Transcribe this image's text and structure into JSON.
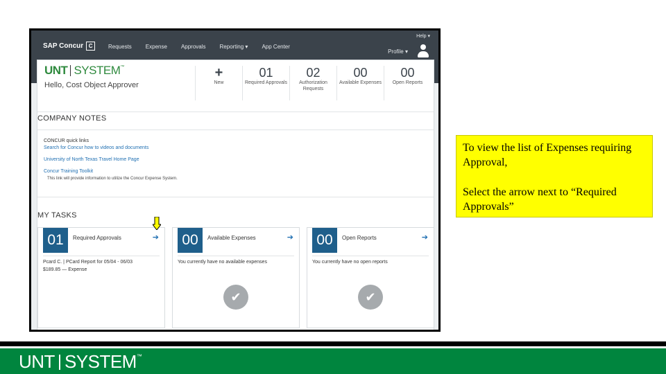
{
  "app": {
    "brand": "SAP Concur",
    "brand_box": "C",
    "nav": [
      "Requests",
      "Expense",
      "Approvals",
      "Reporting ▾",
      "App Center"
    ],
    "help": "Help ▾",
    "profile": "Profile ▾"
  },
  "header": {
    "logo_unt": "UNT",
    "logo_system": "SYSTEM",
    "logo_tm": "™",
    "greeting": "Hello, Cost Object Approver"
  },
  "quick": [
    {
      "num": "+",
      "label": "New"
    },
    {
      "num": "01",
      "label": "Required Approvals"
    },
    {
      "num": "02",
      "label": "Authorization Requests"
    },
    {
      "num": "00",
      "label": "Available Expenses"
    },
    {
      "num": "00",
      "label": "Open Reports"
    }
  ],
  "notes": {
    "title": "COMPANY NOTES",
    "heading": "CONCUR quick links",
    "link1": "Search for Concur how to videos and documents",
    "link2": "University of North Texas Travel Home Page",
    "link3": "Concur Training Toolkit",
    "desc": "This link will provide information to utilize the Concur Expense System."
  },
  "tasks": {
    "title": "MY TASKS",
    "cards": [
      {
        "num": "01",
        "title": "Required Approvals",
        "arrow": "➔",
        "line1": "Pcard C. | PCard Report for 05/04 - 06/03",
        "line2": "$189.85 — Expense"
      },
      {
        "num": "00",
        "title": "Available Expenses",
        "arrow": "➔",
        "line1": "You currently have no available expenses",
        "line2": ""
      },
      {
        "num": "00",
        "title": "Open Reports",
        "arrow": "➔",
        "line1": "You currently have no open reports",
        "line2": ""
      }
    ],
    "check_icon": "✔"
  },
  "callout": {
    "line1": "To view the list of Expenses requiring Approval,",
    "line2": "Select the arrow next to “Required Approvals”"
  },
  "footer": {
    "unt": "UNT",
    "system": "SYSTEM",
    "tm": "™"
  },
  "colors": {
    "navbar": "#3b434b",
    "accent": "#1f5f8b",
    "brand_green": "#00853e",
    "callout": "#ffff00"
  }
}
